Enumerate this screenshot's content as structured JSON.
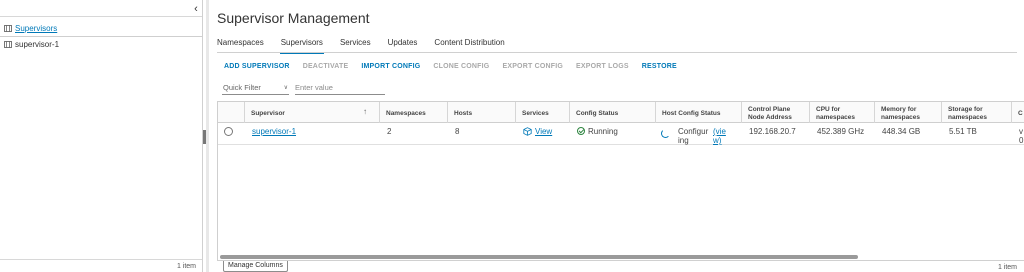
{
  "left_pane": {
    "tree": [
      {
        "label": "Supervisors",
        "icon": "supervisor-cluster-icon",
        "active": true
      },
      {
        "label": "supervisor-1",
        "icon": "supervisor-icon",
        "active": false
      }
    ],
    "item_count": "1 item"
  },
  "header": {
    "title": "Supervisor Management"
  },
  "tabs": [
    {
      "label": "Namespaces",
      "active": false
    },
    {
      "label": "Supervisors",
      "active": true
    },
    {
      "label": "Services",
      "active": false
    },
    {
      "label": "Updates",
      "active": false
    },
    {
      "label": "Content Distribution",
      "active": false
    }
  ],
  "toolbar": {
    "add_supervisor": "ADD SUPERVISOR",
    "deactivate": "DEACTIVATE",
    "import_config": "IMPORT CONFIG",
    "clone_config": "CLONE CONFIG",
    "export_config": "EXPORT CONFIG",
    "export_logs": "EXPORT LOGS",
    "restore": "RESTORE"
  },
  "filter": {
    "quick_filter": "Quick Filter",
    "placeholder": "Enter value"
  },
  "grid": {
    "columns": [
      "Supervisor",
      "Namespaces",
      "Hosts",
      "Services",
      "Config Status",
      "Host Config Status",
      "Control Plane Node Address",
      "CPU for namespaces",
      "Memory for namespaces",
      "Storage for namespaces",
      "C"
    ],
    "rows": [
      {
        "supervisor": "supervisor-1",
        "namespaces": "2",
        "hosts": "8",
        "services": "View",
        "config_status": "Running",
        "host_config_status_a": "Configur",
        "host_config_status_b": "ing",
        "host_config_link_a": "(vie",
        "host_config_link_b": "w)",
        "control_plane": "192.168.20.7",
        "cpu": "452.389 GHz",
        "memory": "448.34 GB",
        "storage": "5.51 TB",
        "extra_a": "v",
        "extra_b": "0"
      }
    ],
    "item_count": "1 item",
    "manage_columns": "Manage Columns"
  },
  "colors": {
    "accent": "#0079b8",
    "success": "#2e8540",
    "disabled": "#a9a9a9"
  }
}
